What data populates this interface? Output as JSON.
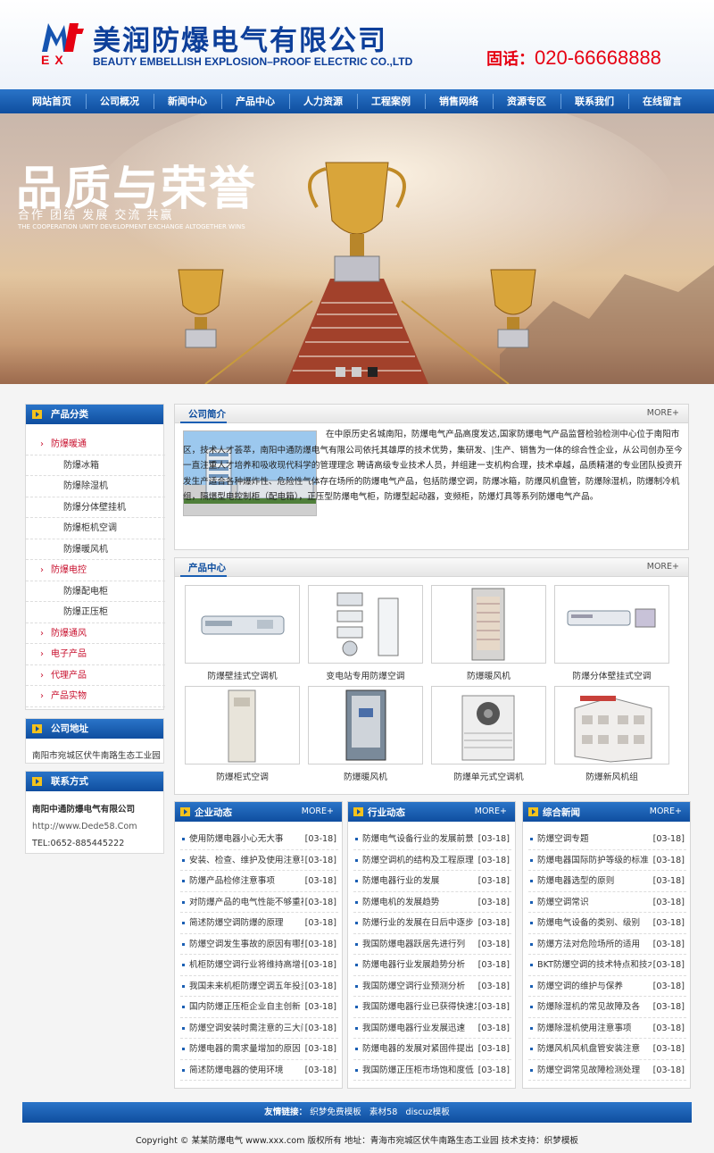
{
  "header": {
    "company_name": "美润防爆电气有限公司",
    "company_name_en": "BEAUTY EMBELLISH EXPLOSION–PROOF ELECTRIC CO.,LTD",
    "logo_letters": "EX",
    "phone_label": "固话：",
    "phone_number": "020-66668888"
  },
  "nav": [
    "网站首页",
    "公司概况",
    "新闻中心",
    "产品中心",
    "人力资源",
    "工程案例",
    "销售网络",
    "资源专区",
    "联系我们",
    "在线留言"
  ],
  "banner": {
    "title": "品质与荣誉",
    "subtitle": "合作  团结  发展  交流  共赢",
    "subtitle_en": "THE COOPERATION UNITY DEVELOPMENT EXCHANGE ALTOGETHER WINS",
    "slides": 3,
    "active_slide": 3
  },
  "sidebar": {
    "categories_title": "产品分类",
    "categories": [
      {
        "label": "防爆暖通",
        "level": "main"
      },
      {
        "label": "防爆冰箱",
        "level": "sub"
      },
      {
        "label": "防爆除湿机",
        "level": "sub"
      },
      {
        "label": "防爆分体壁挂机",
        "level": "sub"
      },
      {
        "label": "防爆柜机空调",
        "level": "sub"
      },
      {
        "label": "防爆暖风机",
        "level": "sub"
      },
      {
        "label": "防爆电控",
        "level": "main"
      },
      {
        "label": "防爆配电柜",
        "level": "sub"
      },
      {
        "label": "防爆正压柜",
        "level": "sub"
      },
      {
        "label": "防爆通风",
        "level": "main"
      },
      {
        "label": "电子产品",
        "level": "main"
      },
      {
        "label": "代理产品",
        "level": "main"
      },
      {
        "label": "产品实物",
        "level": "main"
      }
    ],
    "address_title": "公司地址",
    "address": "南阳市宛城区伏牛南路生态工业园",
    "contact_title": "联系方式",
    "contact_company": "南阳中通防爆电气有限公司",
    "contact_url": "http://www.Dede58.Com",
    "contact_tel": "TEL:0652-885445222"
  },
  "intro": {
    "title": "公司简介",
    "more": "MORE+",
    "text": "在中原历史名城南阳，防爆电气产品高度发达,国家防爆电气产品监督检验检测中心位于南阳市区，技术人才荟萃，南阳中通防爆电气有限公司依托其雄厚的技术优势，集研发、|生产、销售为一体的综合性企业，从公司创办至今一直注重人才培养和吸收现代科学的管理理念 聘请高级专业技术人员，并组建一支机构合理，技术卓越，品质精湛的专业团队投资开发生产适合各种爆炸性、危险性气体存在场所的防爆电气产品，包括防爆空调，防爆冰箱，防爆风机盘管，防爆除湿机，防爆制冷机组，隔爆型电控制柜（配电箱），正压型防爆电气柜，防爆型起动器，变频柜，防爆灯具等系列防爆电气产品。"
  },
  "products": {
    "title": "产品中心",
    "more": "MORE+",
    "items": [
      "防爆壁挂式空调机",
      "变电站专用防爆空调",
      "防爆暖风机",
      "防爆分体壁挂式空调",
      "防爆柜式空调",
      "防爆暖风机",
      "防爆单元式空调机",
      "防爆新风机组"
    ]
  },
  "news": [
    {
      "title": "企业动态",
      "more": "MORE+",
      "items": [
        {
          "t": "使用防爆电器小心无大事",
          "d": "[03-18]"
        },
        {
          "t": "安装、检查、维护及使用注意事项",
          "d": "[03-18]"
        },
        {
          "t": "防爆产品检修注意事项",
          "d": "[03-18]"
        },
        {
          "t": "对防爆产品的电气性能不够重视",
          "d": "[03-18]"
        },
        {
          "t": "简述防爆空调防爆的原理",
          "d": "[03-18]"
        },
        {
          "t": "防爆空调发生事故的原因有哪些",
          "d": "[03-18]"
        },
        {
          "t": "机柜防爆空调行业将维持高增长",
          "d": "[03-18]"
        },
        {
          "t": "我国未来机柜防爆空调五年投资",
          "d": "[03-18]"
        },
        {
          "t": "国内防爆正压柜企业自主创新",
          "d": "[03-18]"
        },
        {
          "t": "防爆空调安装时需注意的三大问题",
          "d": "[03-18]"
        },
        {
          "t": "防爆电器的需求量增加的原因",
          "d": "[03-18]"
        },
        {
          "t": "简述防爆电器的使用环境",
          "d": "[03-18]"
        }
      ]
    },
    {
      "title": "行业动态",
      "more": "MORE+",
      "items": [
        {
          "t": "防爆电气设备行业的发展前景",
          "d": "[03-18]"
        },
        {
          "t": "防爆空调机的结构及工程原理",
          "d": "[03-18]"
        },
        {
          "t": "防爆电器行业的发展",
          "d": "[03-18]"
        },
        {
          "t": "防爆电机的发展趋势",
          "d": "[03-18]"
        },
        {
          "t": "防爆行业的发展在日后中逐步",
          "d": "[03-18]"
        },
        {
          "t": "我国防爆电器跃居先进行列",
          "d": "[03-18]"
        },
        {
          "t": "防爆电器行业发展趋势分析",
          "d": "[03-18]"
        },
        {
          "t": "我国防爆空调行业预测分析",
          "d": "[03-18]"
        },
        {
          "t": "我国防爆电器行业已获得快速发展",
          "d": "[03-18]"
        },
        {
          "t": "我国防爆电器行业发展迅速",
          "d": "[03-18]"
        },
        {
          "t": "防爆电器的发展对紧固件提出",
          "d": "[03-18]"
        },
        {
          "t": "我国防爆正压柜市场饱和度低",
          "d": "[03-18]"
        }
      ]
    },
    {
      "title": "综合新闻",
      "more": "MORE+",
      "items": [
        {
          "t": "防爆空调专题",
          "d": "[03-18]"
        },
        {
          "t": "防爆电器国际防护等级的标准",
          "d": "[03-18]"
        },
        {
          "t": "防爆电器选型的原则",
          "d": "[03-18]"
        },
        {
          "t": "防爆空调常识",
          "d": "[03-18]"
        },
        {
          "t": "防爆电气设备的类别、级别",
          "d": "[03-18]"
        },
        {
          "t": "防爆方法对危险场所的适用",
          "d": "[03-18]"
        },
        {
          "t": "BKT防爆空调的技术特点和技术",
          "d": "[03-18]"
        },
        {
          "t": "防爆空调的维护与保养",
          "d": "[03-18]"
        },
        {
          "t": "防爆除湿机的常见故障及各",
          "d": "[03-18]"
        },
        {
          "t": "防爆除湿机使用注意事项",
          "d": "[03-18]"
        },
        {
          "t": "防爆风机风机盘管安装注意",
          "d": "[03-18]"
        },
        {
          "t": "防爆空调常见故障检测处理",
          "d": "[03-18]"
        }
      ]
    }
  ],
  "footer": {
    "friend_label": "友情链接：",
    "friend_links": [
      "织梦免费模板",
      "素材58",
      "discuz模板"
    ],
    "copyright": "Copyright © 某某防爆电气 www.xxx.com 版权所有   地址：青海市宛城区伏牛南路生态工业园   技术支持：织梦模板"
  },
  "colors": {
    "brand_blue": "#0f4e9f",
    "accent_red": "#e60012",
    "nav_blue": "#2a74c8"
  }
}
